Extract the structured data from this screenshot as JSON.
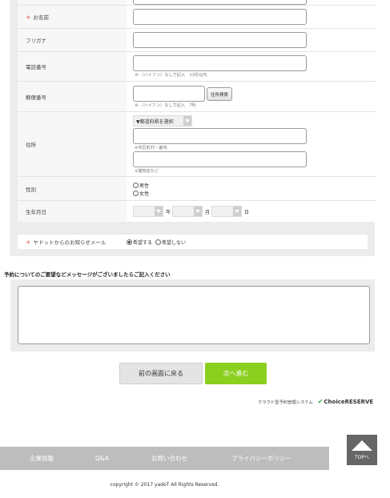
{
  "form": {
    "name_label": "お名前",
    "kana_label": "フリガナ",
    "phone_label": "電話番号",
    "phone_hint": "※-（ハイフン）なしで記入　11桁以内",
    "zip_label": "郵便番号",
    "zip_hint": "※-（ハイフン）なしで記入　7桁",
    "zip_search_button": "住所検索",
    "address_label": "住所",
    "prefecture_select": "▼都道府県を選択",
    "address1_hint": "※市区町村・番地",
    "address2_hint": "※建物名など",
    "gender_label": "性別",
    "gender_options": [
      "男性",
      "女性"
    ],
    "birthday_label": "生年月日",
    "year_unit": "年",
    "month_unit": "月",
    "day_unit": "日",
    "notify_label": "ヤドットからのお知らせメール",
    "notify_options": [
      "希望する",
      "希望しない"
    ],
    "required_mark": "＊"
  },
  "message": {
    "title": "予約についてのご要望などメッセージがございましたらご記入ください"
  },
  "buttons": {
    "back": "前の画面に戻る",
    "next": "次へ進む"
  },
  "powered": {
    "text": "クラウド型予約管理システム",
    "logo": "ChoiceRESERVE",
    "logo_mark": "✔"
  },
  "footer": {
    "nav": [
      "企業情報",
      "Q&A",
      "お問い合わせ",
      "プライバシーポリシー"
    ],
    "top_button": "TOPへ",
    "copyright": "copyright © 2017 yadoT All Rights Reserved."
  },
  "colors": {
    "accent_green": "#8bcf1f",
    "required_red": "#e0393e",
    "footer_gray": "#bdbdbd"
  }
}
